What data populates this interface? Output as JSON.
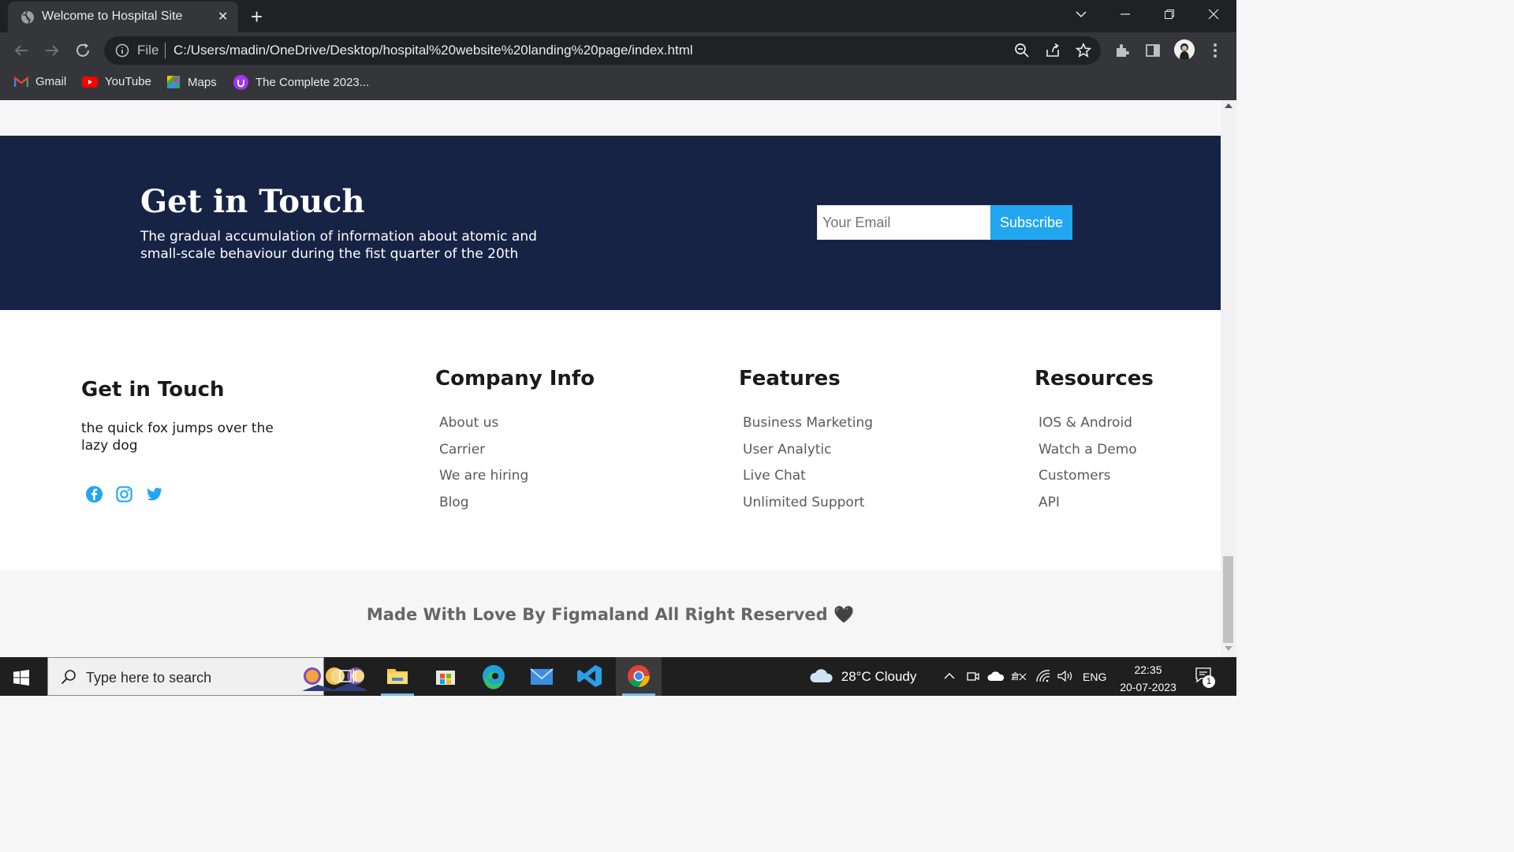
{
  "browser": {
    "tab_title": "Welcome to Hospital Site",
    "close_glyph": "✕",
    "newtab_glyph": "+",
    "url_scheme": "File",
    "url": "C:/Users/madin/OneDrive/Desktop/hospital%20website%20landing%20page/index.html",
    "bookmarks": [
      {
        "label": "Gmail",
        "icon": "gmail-icon"
      },
      {
        "label": "YouTube",
        "icon": "youtube-icon"
      },
      {
        "label": "Maps",
        "icon": "maps-icon"
      },
      {
        "label": "The Complete 2023...",
        "icon": "udemy-icon"
      }
    ]
  },
  "cta": {
    "title": "Get in Touch",
    "text": "The gradual accumulation of information about atomic and small-scale behaviour during the fist quarter of the 20th",
    "email_placeholder": "Your Email",
    "subscribe_label": "Subscribe"
  },
  "footer": {
    "contact": {
      "title": "Get in Touch",
      "tagline": "the quick fox jumps over the lazy dog",
      "socials": [
        "facebook-icon",
        "instagram-icon",
        "twitter-icon"
      ]
    },
    "columns": [
      {
        "title": "Company Info",
        "links": [
          "About us",
          "Carrier",
          "We are hiring",
          "Blog"
        ]
      },
      {
        "title": "Features",
        "links": [
          "Business Marketing",
          "User Analytic",
          "Live Chat",
          "Unlimited Support"
        ]
      },
      {
        "title": "Resources",
        "links": [
          "IOS & Android",
          "Watch a Demo",
          "Customers",
          "API"
        ]
      }
    ],
    "copyright": "Made With Love By Figmaland All Right Reserved 🖤"
  },
  "taskbar": {
    "search_placeholder": "Type here to search",
    "weather": "28°C  Cloudy",
    "language": "ENG",
    "time": "22:35",
    "date": "20-07-2023",
    "notification_count": "1"
  },
  "colors": {
    "cta_bg": "#172345",
    "accent": "#23a6f0",
    "social": "#23a6f0"
  }
}
